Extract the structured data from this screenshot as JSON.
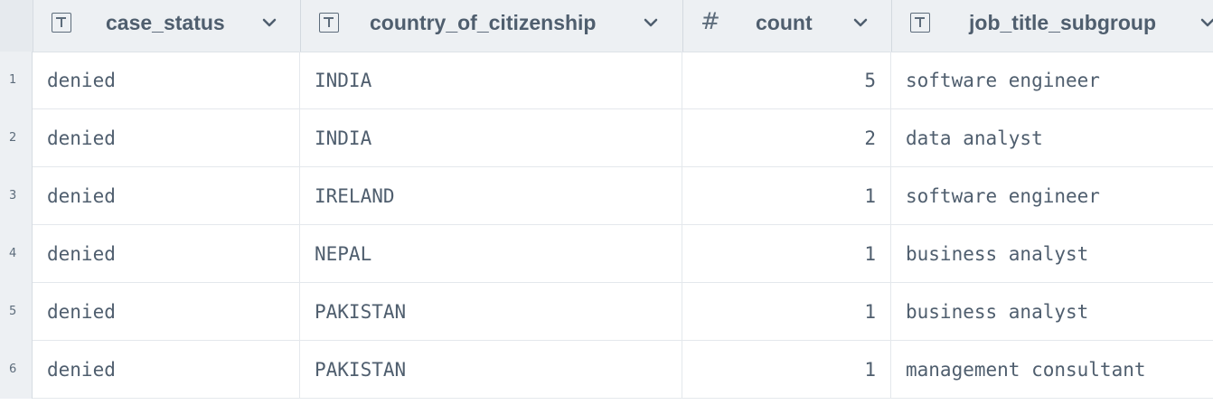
{
  "columns": [
    {
      "name": "case_status",
      "type_icon": "text-type-icon"
    },
    {
      "name": "country_of_citizenship",
      "type_icon": "text-type-icon"
    },
    {
      "name": "count",
      "type_icon": "number-type-icon",
      "type_glyph": "#"
    },
    {
      "name": "job_title_subgroup",
      "type_icon": "text-type-icon"
    }
  ],
  "rows": [
    {
      "n": "1",
      "case_status": "denied",
      "country": "INDIA",
      "count": "5",
      "job": "software engineer"
    },
    {
      "n": "2",
      "case_status": "denied",
      "country": "INDIA",
      "count": "2",
      "job": "data analyst"
    },
    {
      "n": "3",
      "case_status": "denied",
      "country": "IRELAND",
      "count": "1",
      "job": "software engineer"
    },
    {
      "n": "4",
      "case_status": "denied",
      "country": "NEPAL",
      "count": "1",
      "job": "business analyst"
    },
    {
      "n": "5",
      "case_status": "denied",
      "country": "PAKISTAN",
      "count": "1",
      "job": "business analyst"
    },
    {
      "n": "6",
      "case_status": "denied",
      "country": "PAKISTAN",
      "count": "1",
      "job": "management consultant"
    }
  ]
}
